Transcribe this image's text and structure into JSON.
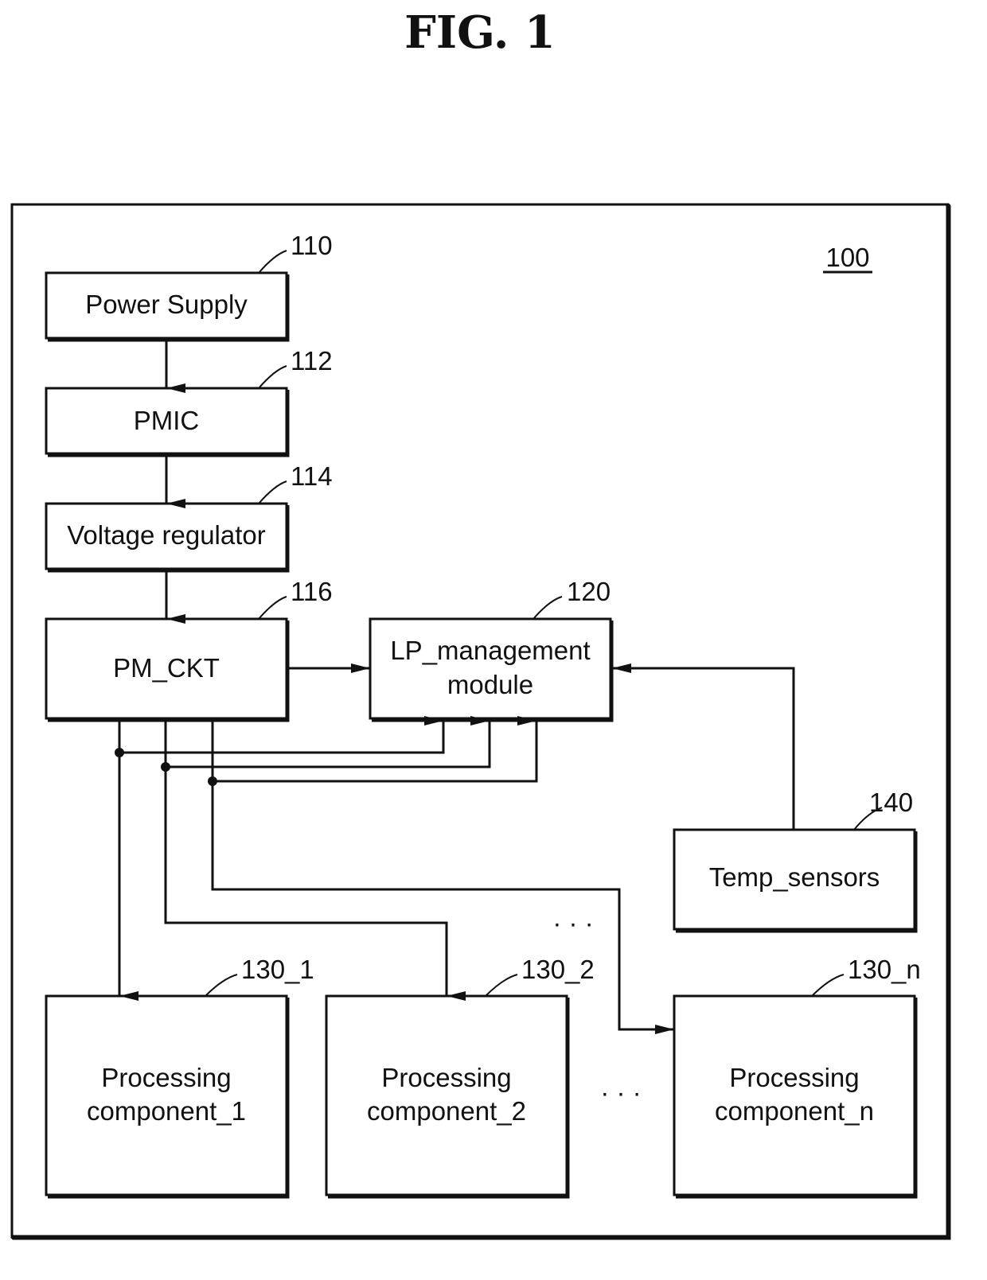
{
  "figure": {
    "title": "FIG.  1",
    "system_ref": "100"
  },
  "blocks": {
    "power_supply": {
      "label": "Power Supply",
      "ref": "110"
    },
    "pmic": {
      "label": "PMIC",
      "ref": "112"
    },
    "voltage_regulator": {
      "label": "Voltage regulator",
      "ref": "114"
    },
    "pm_ckt": {
      "label": "PM_CKT",
      "ref": "116"
    },
    "lp_management": {
      "label_line1": "LP_management",
      "label_line2": "module",
      "ref": "120"
    },
    "temp_sensors": {
      "label": "Temp_sensors",
      "ref": "140"
    },
    "pc1": {
      "label_line1": "Processing",
      "label_line2": "component_1",
      "ref": "130_1"
    },
    "pc2": {
      "label_line1": "Processing",
      "label_line2": "component_2",
      "ref": "130_2"
    },
    "pcn": {
      "label_line1": "Processing",
      "label_line2": "component_n",
      "ref": "130_n"
    }
  },
  "ellipsis": "· · ·"
}
